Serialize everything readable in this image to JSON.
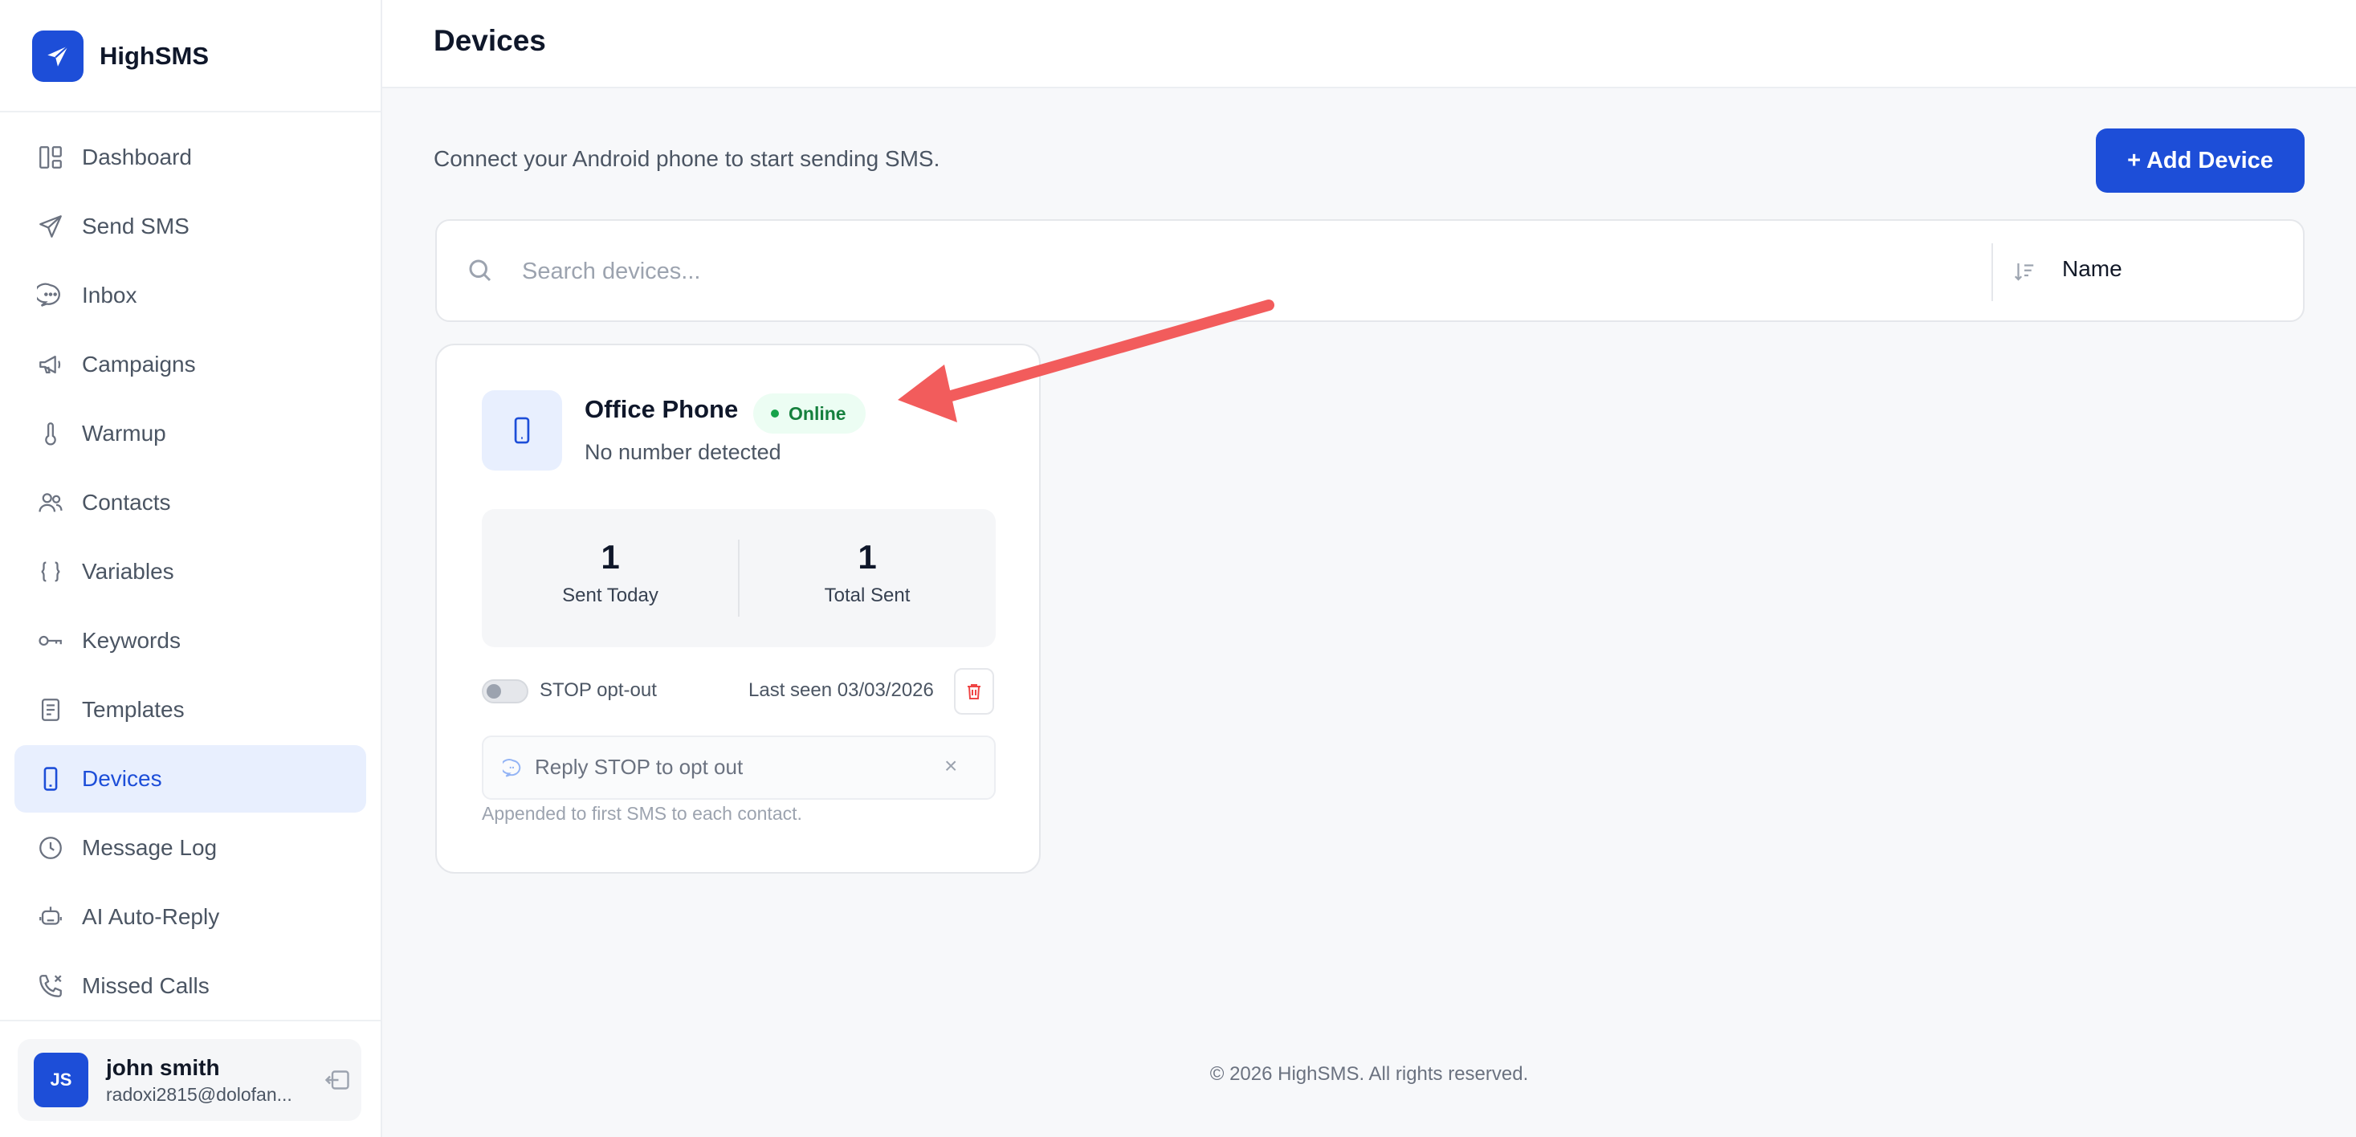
{
  "app": {
    "name": "HighSMS"
  },
  "sidebar": {
    "items": [
      {
        "label": "Dashboard",
        "icon": "dashboard-icon"
      },
      {
        "label": "Send SMS",
        "icon": "send-icon"
      },
      {
        "label": "Inbox",
        "icon": "chat-icon"
      },
      {
        "label": "Campaigns",
        "icon": "megaphone-icon"
      },
      {
        "label": "Warmup",
        "icon": "thermometer-icon"
      },
      {
        "label": "Contacts",
        "icon": "users-icon"
      },
      {
        "label": "Variables",
        "icon": "braces-icon"
      },
      {
        "label": "Keywords",
        "icon": "key-icon"
      },
      {
        "label": "Templates",
        "icon": "document-icon"
      },
      {
        "label": "Devices",
        "icon": "phone-icon",
        "active": true
      },
      {
        "label": "Message Log",
        "icon": "clock-icon"
      },
      {
        "label": "AI Auto-Reply",
        "icon": "robot-icon"
      },
      {
        "label": "Missed Calls",
        "icon": "missed-call-icon"
      }
    ],
    "user": {
      "initials": "JS",
      "name": "john smith",
      "email": "radoxi2815@dolofan..."
    }
  },
  "header": {
    "title": "Devices"
  },
  "main": {
    "subtitle": "Connect your Android phone to start sending SMS.",
    "add_button": "+ Add Device",
    "search": {
      "placeholder": "Search devices...",
      "value": ""
    },
    "sort": {
      "selected": "Name"
    }
  },
  "device": {
    "name": "Office Phone",
    "status": "Online",
    "number": "No number detected",
    "stats": [
      {
        "value": "1",
        "label": "Sent Today"
      },
      {
        "value": "1",
        "label": "Total Sent"
      }
    ],
    "stop_optout_label": "STOP opt-out",
    "stop_optout_enabled": false,
    "last_seen": "Last seen 03/03/2026",
    "optout_message": "Reply STOP to opt out",
    "optout_help": "Appended to first SMS to each contact."
  },
  "footer": {
    "copyright": "© 2026 HighSMS. All rights reserved."
  },
  "colors": {
    "brand": "#1d4ed8",
    "online": "#16a34a",
    "delete": "#ef4444",
    "annotation": "#f25c5c"
  }
}
